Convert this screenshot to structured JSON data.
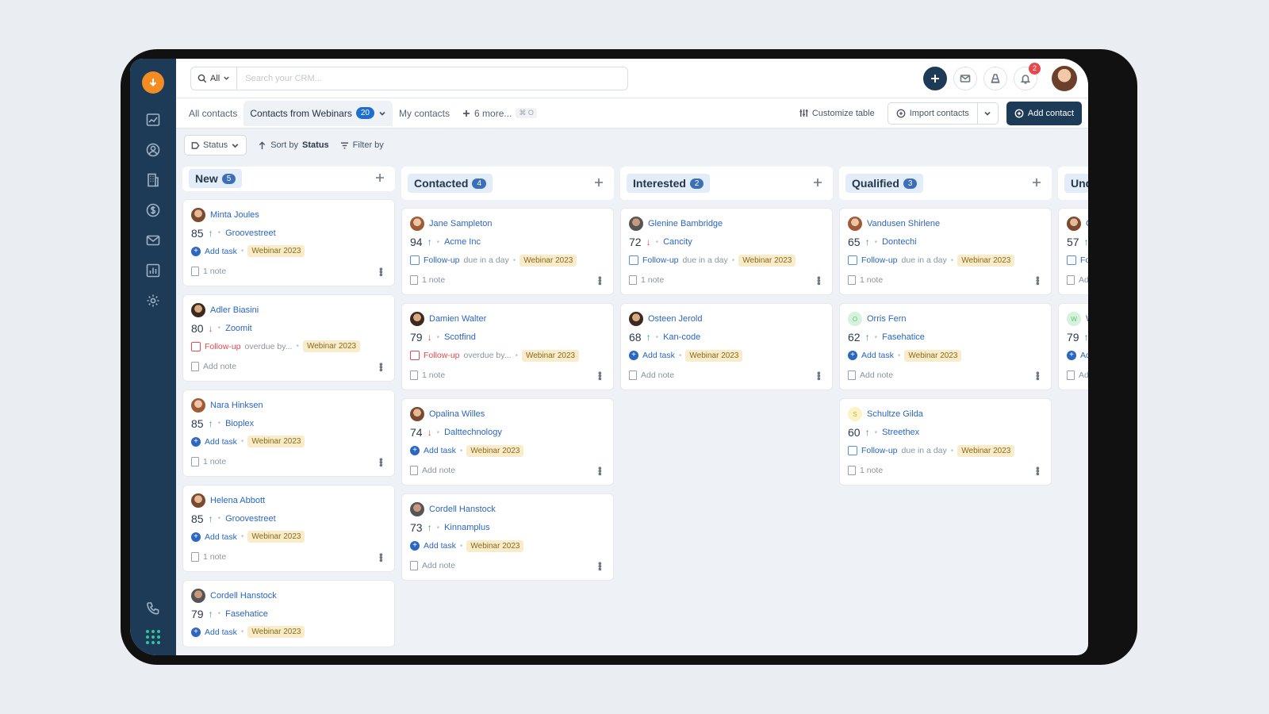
{
  "search": {
    "scope": "All",
    "placeholder": "Search your CRM..."
  },
  "header": {
    "notifications_count": "2"
  },
  "tabs": [
    {
      "label": "All contacts"
    },
    {
      "label": "Contacts from Webinars",
      "count": "20"
    },
    {
      "label": "My contacts"
    },
    {
      "label": "6 more...",
      "shortcut": "⌘ O"
    }
  ],
  "actions": {
    "customize": "Customize table",
    "import": "Import contacts",
    "add_contact": "Add contact"
  },
  "filters": {
    "status": "Status",
    "sort_prefix": "Sort by",
    "sort_field": "Status",
    "filter": "Filter by"
  },
  "columns": [
    {
      "title": "New",
      "count": "5",
      "cards": [
        {
          "name": "Minta Joules",
          "score": "85",
          "trend": "up",
          "company": "Groovestreet",
          "task_type": "add",
          "task": "Add task",
          "due": "",
          "tag": "Webinar 2023",
          "note": "1 note",
          "avatar": "a1"
        },
        {
          "name": "Adler Biasini",
          "score": "80",
          "trend": "down",
          "company": "Zoomit",
          "task_type": "overdue",
          "task": "Follow-up",
          "due": "overdue by...",
          "tag": "Webinar 2023",
          "note": "Add note",
          "avatar": "a2"
        },
        {
          "name": "Nara Hinksen",
          "score": "85",
          "trend": "up",
          "company": "Bioplex",
          "task_type": "add",
          "task": "Add task",
          "due": "",
          "tag": "Webinar 2023",
          "note": "1 note",
          "avatar": "a3"
        },
        {
          "name": "Helena Abbott",
          "score": "85",
          "trend": "up",
          "company": "Groovestreet",
          "task_type": "add",
          "task": "Add task",
          "due": "",
          "tag": "Webinar 2023",
          "note": "1 note",
          "avatar": "a1"
        },
        {
          "name": "Cordell Hanstock",
          "score": "79",
          "trend": "up",
          "company": "Fasehatice",
          "task_type": "add",
          "task": "Add task",
          "due": "",
          "tag": "Webinar 2023",
          "note": "",
          "avatar": "a4"
        }
      ]
    },
    {
      "title": "Contacted",
      "count": "4",
      "cards": [
        {
          "name": "Jane Sampleton",
          "score": "94",
          "trend": "up",
          "company": "Acme Inc",
          "task_type": "follow",
          "task": "Follow-up",
          "due": "due in a day",
          "tag": "Webinar 2023",
          "note": "1 note",
          "avatar": "a3"
        },
        {
          "name": "Damien Walter",
          "score": "79",
          "trend": "down",
          "company": "Scotfind",
          "task_type": "overdue",
          "task": "Follow-up",
          "due": "overdue by...",
          "tag": "Webinar 2023",
          "note": "1 note",
          "avatar": "a2"
        },
        {
          "name": "Opalina Willes",
          "score": "74",
          "trend": "down",
          "company": "Dalttechnology",
          "task_type": "add",
          "task": "Add task",
          "due": "",
          "tag": "Webinar 2023",
          "note": "Add note",
          "avatar": "a1"
        },
        {
          "name": "Cordell Hanstock",
          "score": "73",
          "trend": "up",
          "company": "Kinnamplus",
          "task_type": "add",
          "task": "Add task",
          "due": "",
          "tag": "Webinar 2023",
          "note": "Add note",
          "avatar": "a4"
        }
      ]
    },
    {
      "title": "Interested",
      "count": "2",
      "cards": [
        {
          "name": "Glenine Bambridge",
          "score": "72",
          "trend": "down",
          "company": "Cancity",
          "task_type": "follow",
          "task": "Follow-up",
          "due": "due in a day",
          "tag": "Webinar 2023",
          "note": "1 note",
          "avatar": "a4"
        },
        {
          "name": "Osteen Jerold",
          "score": "68",
          "trend": "up",
          "company": "Kan-code",
          "task_type": "add",
          "task": "Add task",
          "due": "",
          "tag": "Webinar 2023",
          "note": "Add note",
          "avatar": "a2"
        }
      ]
    },
    {
      "title": "Qualified",
      "count": "3",
      "cards": [
        {
          "name": "Vandusen Shirlene",
          "score": "65",
          "trend": "up",
          "company": "Dontechi",
          "task_type": "follow",
          "task": "Follow-up",
          "due": "due in a day",
          "tag": "Webinar 2023",
          "note": "1 note",
          "avatar": "a3"
        },
        {
          "name": "Orris Fern",
          "score": "62",
          "trend": "up",
          "company": "Fasehatice",
          "task_type": "add",
          "task": "Add task",
          "due": "",
          "tag": "Webinar 2023",
          "note": "Add note",
          "avatar": "init-green",
          "initial": "O"
        },
        {
          "name": "Schultze Gilda",
          "score": "60",
          "trend": "up",
          "company": "Streethex",
          "task_type": "follow",
          "task": "Follow-up",
          "due": "due in a day",
          "tag": "Webinar 2023",
          "note": "1 note",
          "avatar": "init-yellow",
          "initial": "S"
        }
      ]
    },
    {
      "title": "Unqualifie",
      "count": "",
      "cards": [
        {
          "name": "Gutows",
          "score": "57",
          "trend": "up",
          "company": "D",
          "task_type": "follow",
          "task": "Follow-up",
          "due": "",
          "tag": "",
          "note": "Add note",
          "avatar": "a1"
        },
        {
          "name": "Worces",
          "score": "79",
          "trend": "up",
          "company": "F",
          "task_type": "add",
          "task": "Add task",
          "due": "",
          "tag": "",
          "note": "Add note",
          "avatar": "init-green",
          "initial": "W"
        }
      ]
    }
  ],
  "colors": {
    "sidebar": "#1d3a56",
    "accent": "#1d6fcf",
    "logo": "#f48c24",
    "up": "#22a06b",
    "down": "#e5484d"
  }
}
